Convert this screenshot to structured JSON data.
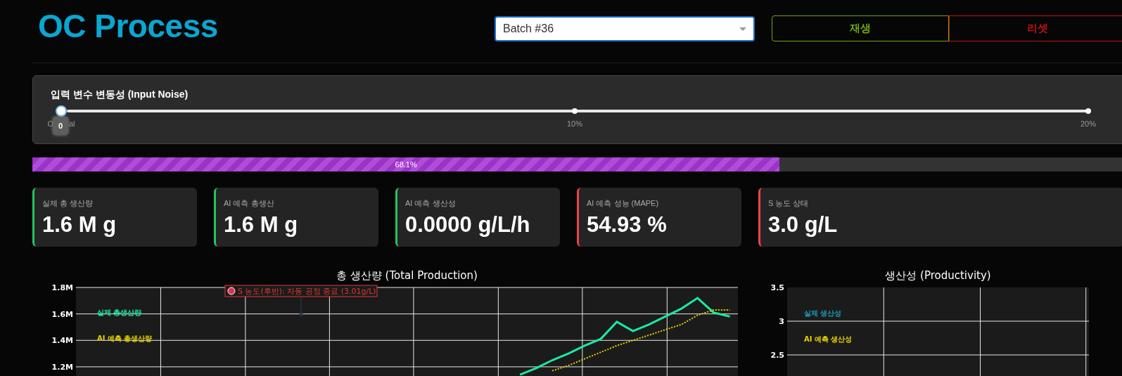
{
  "header": {
    "title": "OC Process",
    "batch_select": {
      "value": "Batch #36"
    },
    "buttons": [
      {
        "label": "재생",
        "color": "#6fa80c"
      },
      {
        "label": "리셋",
        "color": "#c41010"
      }
    ]
  },
  "noise_slider": {
    "label": "입력 변수 변동성 (Input Noise)",
    "level": 0,
    "value": "0",
    "marks": [
      {
        "texts": [
          "O",
          "al"
        ]
      },
      {
        "texts": [
          "10%"
        ]
      },
      {
        "texts": [
          "20%"
        ]
      }
    ]
  },
  "progress": {
    "level": 0.681,
    "text": "68.1%"
  },
  "cards": [
    {
      "label": "실제 총 생산량",
      "value": "1.6 M g",
      "color": "#22c55e"
    },
    {
      "label": "AI 예측 총생산",
      "value": "1.6 M g",
      "color": "#22c55e"
    },
    {
      "label": "AI 예측 생산성",
      "value": "0.0000 g/L/h",
      "color": "#22c55e"
    },
    {
      "label": "AI 예측 성능 (MAPE)",
      "value": "54.93 %",
      "color": "#ef4444"
    },
    {
      "label": "S 농도 상태",
      "value": "3.0 g/L",
      "color": "#ef4444"
    }
  ],
  "charts": [
    {
      "title": "총 생산량 (Total Production)",
      "chart_data": {
        "type": "line",
        "ylim": [
          1.12,
          1.8
        ],
        "grid": true,
        "yticks": [
          {
            "value": 1.2,
            "label": "1.2M"
          },
          {
            "value": 1.4,
            "label": "1.4M"
          },
          {
            "value": 1.6,
            "label": "1.6M"
          },
          {
            "value": 1.8,
            "label": "1.8M"
          }
        ],
        "categories": [
          null,
          null,
          null,
          null,
          null,
          null,
          null,
          null,
          null,
          null,
          null,
          null,
          null,
          null,
          null,
          null,
          null,
          null,
          null,
          null,
          null,
          null,
          null,
          null,
          null,
          null,
          null,
          null,
          null,
          null,
          null,
          null,
          null,
          null,
          null,
          null,
          null,
          null,
          null,
          null,
          null
        ],
        "series": [
          {
            "name": "실제 총생산량",
            "color": "#1de9a0",
            "line_style": "solid",
            "values": [
              null,
              null,
              null,
              null,
              null,
              null,
              null,
              null,
              null,
              null,
              null,
              null,
              null,
              null,
              null,
              null,
              null,
              null,
              null,
              null,
              null,
              null,
              null,
              null,
              null,
              null,
              null,
              1.14,
              1.19,
              1.25,
              1.3,
              1.36,
              1.41,
              1.54,
              1.47,
              1.52,
              1.58,
              1.64,
              1.72,
              1.61,
              1.58
            ]
          },
          {
            "name": "AI 예측 총생산량",
            "color": "#e6d200",
            "line_style": "dotted",
            "values": [
              null,
              null,
              null,
              null,
              null,
              null,
              null,
              null,
              null,
              null,
              null,
              null,
              null,
              null,
              null,
              null,
              null,
              null,
              null,
              null,
              null,
              null,
              null,
              null,
              null,
              null,
              null,
              null,
              null,
              1.17,
              1.21,
              1.26,
              1.31,
              1.36,
              1.4,
              1.44,
              1.48,
              1.52,
              1.59,
              1.63,
              1.63
            ]
          }
        ],
        "annotations": [
          {
            "text": "S 농도(후반): 자동 공정 종료 (3.01g/L)"
          }
        ]
      }
    },
    {
      "title": "생산성 (Productivity)",
      "y_labels": [
        "3.5",
        "3",
        "2.5"
      ],
      "legend": [
        {
          "text": "실제 생산성",
          "color": "#1b9cb8"
        },
        {
          "text": "AI 예측 생산성",
          "color": "#e8d200"
        }
      ]
    }
  ]
}
